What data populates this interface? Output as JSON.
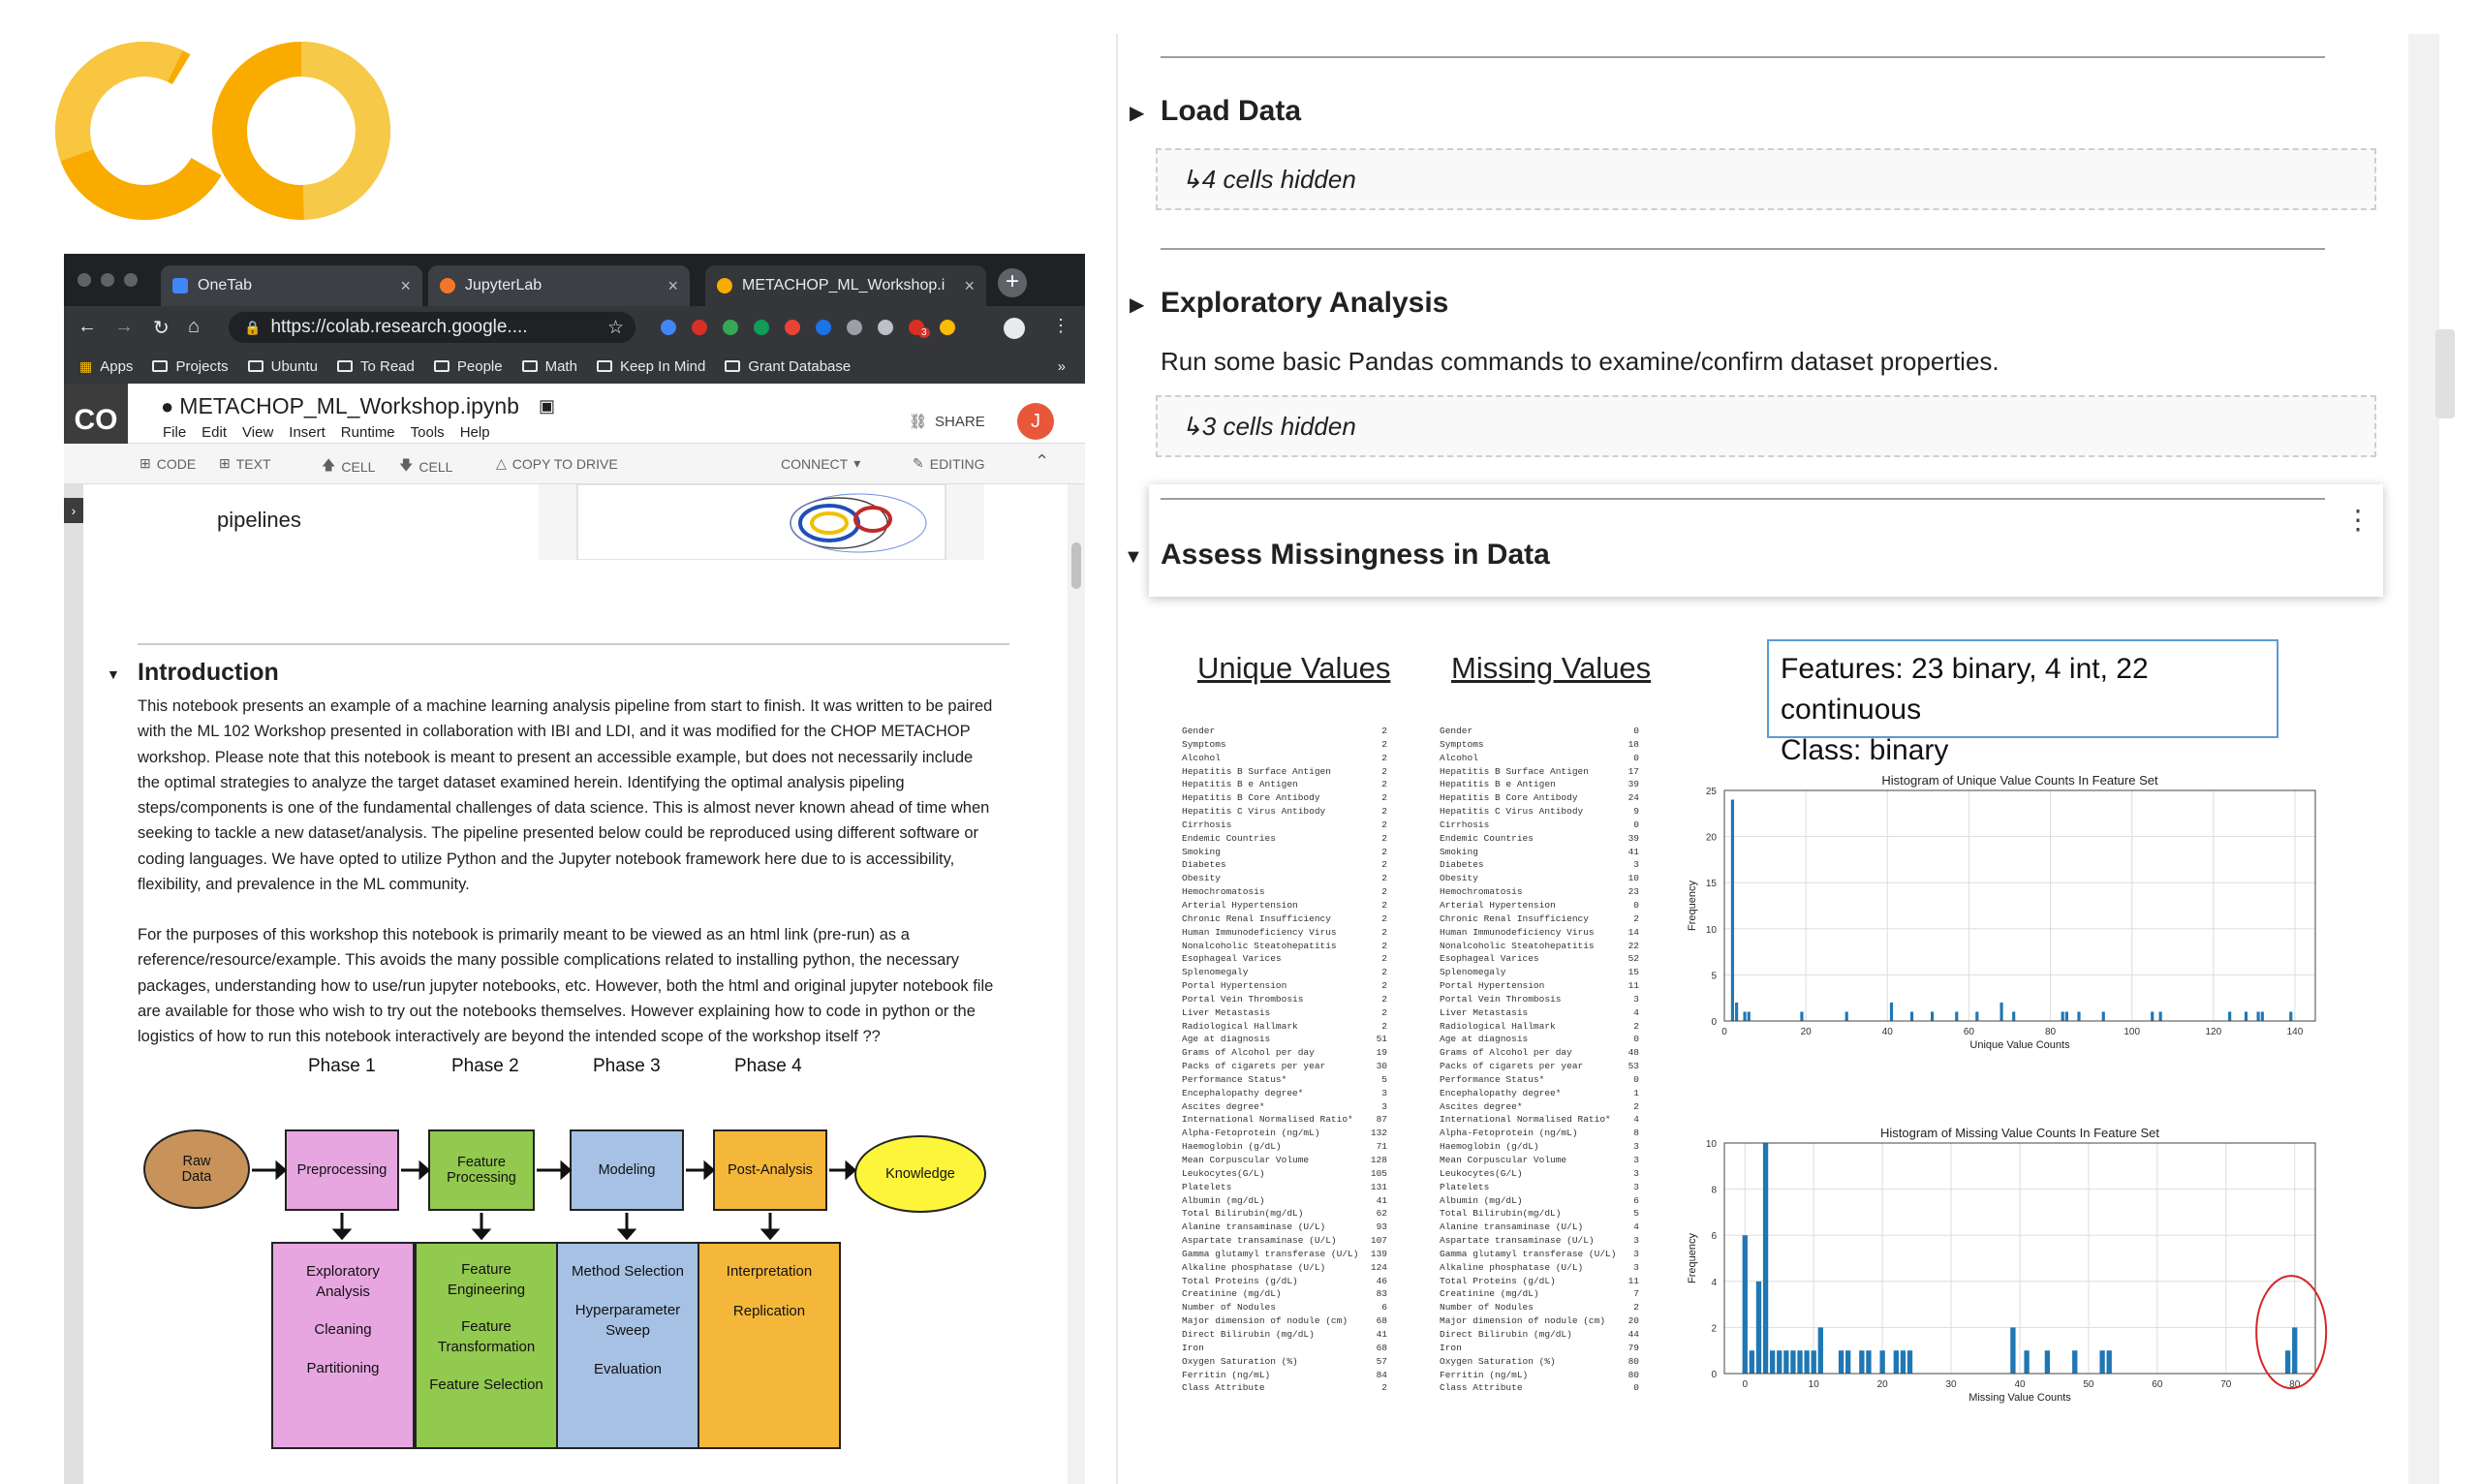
{
  "logo": {
    "text": "CO"
  },
  "browser": {
    "tabs": [
      {
        "title": "OneTab",
        "close": "×",
        "color": "#4285f4"
      },
      {
        "title": "JupyterLab",
        "close": "×",
        "color": "#f37626"
      },
      {
        "title": "METACHOP_ML_Workshop.i",
        "close": "×",
        "color": "#f9ab00"
      }
    ],
    "new_tab": "+",
    "url": "https://colab.research.google....",
    "bookmarks": [
      "Apps",
      "Projects",
      "Ubuntu",
      "To Read",
      "People",
      "Math",
      "Keep In Mind",
      "Grant Database"
    ],
    "more": "»",
    "ext_badge": "3"
  },
  "colab": {
    "logo": "CO",
    "title": "METACHOP_ML_Workshop.ipynb",
    "menus": [
      "File",
      "Edit",
      "View",
      "Insert",
      "Runtime",
      "Tools",
      "Help"
    ],
    "share": "SHARE",
    "avatar": "J",
    "toolbar": {
      "code": "CODE",
      "text": "TEXT",
      "cell_up": "CELL",
      "cell_down": "CELL",
      "copy": "COPY TO DRIVE",
      "connect": "CONNECT",
      "editing": "EDITING"
    },
    "pipelines": "pipelines",
    "intro_heading": "Introduction",
    "intro_p1": "This notebook presents an example of a machine learning analysis pipeline from start to finish. It was written to be paired with the ML 102 Workshop presented in collaboration with IBI and LDI, and it was modified for the CHOP METACHOP workshop. Please note that this notebook is meant to present an accessible example, but does not necessarily include the optimal strategies to analyze the target dataset examined herein. Identifying the optimal analysis pipeling steps/components is one of the fundamental challenges of data science. This is almost never known ahead of time when seeking to tackle a new dataset/analysis. The pipeline presented below could be reproduced using different software or coding languages. We have opted to utilize Python and the Jupyter notebook framework here due to is accessibility, flexibility, and prevalence in the ML community.",
    "intro_p2": "For the purposes of this workshop this notebook is primarily meant to be viewed as an html link (pre-run) as a reference/resource/example. This avoids the many possible complications related to installing python, the necessary packages, understanding how to use/run jupyter notebooks, etc. However, both the html and original jupyter notebook file are available for those who wish to try out the notebooks themselves. However explaining how to code in python or the logistics of how to run this notebook interactively are beyond the intended scope of the workshop itself ??"
  },
  "flow": {
    "phases": [
      "Phase 1",
      "Phase 2",
      "Phase 3",
      "Phase 4"
    ],
    "raw": [
      "Raw",
      "Data"
    ],
    "steps": [
      "Preprocessing",
      "Feature Processing",
      "Modeling",
      "Post-Analysis"
    ],
    "knowledge": "Knowledge",
    "colors": {
      "pre": "#e8a6e0",
      "feat": "#92c94f",
      "model": "#a6c1e4",
      "post": "#f5b73a",
      "raw": "#c8935a",
      "know": "#fdf53a"
    },
    "details": [
      [
        "Exploratory Analysis",
        "Cleaning",
        "Partitioning"
      ],
      [
        "Feature Engineering",
        "Feature Transformation",
        "Feature Selection"
      ],
      [
        "Method Selection",
        "Hyperparameter Sweep",
        "Evaluation"
      ],
      [
        "Interpretation",
        "Replication"
      ]
    ]
  },
  "right": {
    "load_data": "Load Data",
    "load_hidden": "↳4 cells hidden",
    "explore": "Exploratory Analysis",
    "explore_desc": "Run some basic Pandas commands to examine/confirm dataset properties.",
    "explore_hidden": "↳3 cells hidden",
    "assess": "Assess Missingness in Data",
    "unique_title": "Unique Values",
    "missing_title": "Missing Values",
    "features_line1": "Features: 23 binary, 4 int, 22 continuous",
    "features_line2": "Class: binary",
    "features": [
      "Gender",
      "Symptoms",
      "Alcohol",
      "Hepatitis B Surface Antigen",
      "Hepatitis B e Antigen",
      "Hepatitis B Core Antibody",
      "Hepatitis C Virus Antibody",
      "Cirrhosis",
      "Endemic Countries",
      "Smoking",
      "Diabetes",
      "Obesity",
      "Hemochromatosis",
      "Arterial Hypertension",
      "Chronic Renal Insufficiency",
      "Human Immunodeficiency Virus",
      "Nonalcoholic Steatohepatitis",
      "Esophageal Varices",
      "Splenomegaly",
      "Portal Hypertension",
      "Portal Vein Thrombosis",
      "Liver Metastasis",
      "Radiological Hallmark",
      "Age at diagnosis",
      "Grams of Alcohol per day",
      "Packs of cigarets per year",
      "Performance Status*",
      "Encephalopathy degree*",
      "Ascites degree*",
      "International Normalised Ratio*",
      "Alpha-Fetoprotein (ng/mL)",
      "Haemoglobin (g/dL)",
      "Mean Corpuscular Volume",
      "Leukocytes(G/L)",
      "Platelets",
      "Albumin (mg/dL)",
      "Total Bilirubin(mg/dL)",
      "Alanine transaminase (U/L)",
      "Aspartate transaminase (U/L)",
      "Gamma glutamyl transferase (U/L)",
      "Alkaline phosphatase (U/L)",
      "Total Proteins (g/dL)",
      "Creatinine (mg/dL)",
      "Number of Nodules",
      "Major dimension of nodule (cm)",
      "Direct Bilirubin (mg/dL)",
      "Iron",
      "Oxygen Saturation (%)",
      "Ferritin (ng/mL)",
      "Class Attribute"
    ],
    "unique_counts": [
      2,
      2,
      2,
      2,
      2,
      2,
      2,
      2,
      2,
      2,
      2,
      2,
      2,
      2,
      2,
      2,
      2,
      2,
      2,
      2,
      2,
      2,
      2,
      51,
      19,
      30,
      5,
      3,
      3,
      87,
      132,
      71,
      128,
      105,
      131,
      41,
      62,
      93,
      107,
      139,
      124,
      46,
      83,
      6,
      68,
      41,
      68,
      57,
      84,
      2
    ],
    "missing_counts": [
      0,
      18,
      0,
      17,
      39,
      24,
      9,
      0,
      39,
      41,
      3,
      10,
      23,
      0,
      2,
      14,
      22,
      52,
      15,
      11,
      3,
      4,
      2,
      0,
      48,
      53,
      0,
      1,
      2,
      4,
      8,
      3,
      3,
      3,
      3,
      6,
      5,
      4,
      3,
      3,
      3,
      11,
      7,
      2,
      20,
      44,
      79,
      80,
      80,
      0
    ]
  },
  "chart_data": [
    {
      "type": "bar",
      "title": "Histogram of Unique Value Counts In Feature Set",
      "xlabel": "Unique Value Counts",
      "ylabel": "Frequency",
      "xlim": [
        0,
        145
      ],
      "ylim": [
        0,
        25
      ],
      "xticks": [
        0,
        20,
        40,
        60,
        80,
        100,
        120,
        140
      ],
      "yticks": [
        0,
        5,
        10,
        15,
        20,
        25
      ],
      "x": [
        2,
        3,
        5,
        6,
        19,
        30,
        41,
        46,
        51,
        57,
        62,
        68,
        71,
        83,
        84,
        87,
        93,
        105,
        107,
        124,
        128,
        131,
        132,
        139
      ],
      "values": [
        24,
        2,
        1,
        1,
        1,
        1,
        2,
        1,
        1,
        1,
        1,
        2,
        1,
        1,
        1,
        1,
        1,
        1,
        1,
        1,
        1,
        1,
        1,
        1
      ],
      "color": "#1f77b4"
    },
    {
      "type": "bar",
      "title": "Histogram of Missing Value Counts In Feature Set",
      "xlabel": "Missing Value Counts",
      "ylabel": "Frequency",
      "xlim": [
        -3,
        83
      ],
      "ylim": [
        0,
        10
      ],
      "xticks": [
        0,
        10,
        20,
        30,
        40,
        50,
        60,
        70,
        80
      ],
      "yticks": [
        0,
        2,
        4,
        6,
        8,
        10
      ],
      "x": [
        0,
        1,
        2,
        3,
        4,
        5,
        6,
        7,
        8,
        9,
        10,
        11,
        14,
        15,
        17,
        18,
        20,
        22,
        23,
        24,
        39,
        41,
        44,
        48,
        52,
        53,
        79,
        80
      ],
      "values": [
        6,
        1,
        4,
        10,
        1,
        1,
        1,
        1,
        1,
        1,
        1,
        2,
        1,
        1,
        1,
        1,
        1,
        1,
        1,
        1,
        2,
        1,
        1,
        1,
        1,
        1,
        1,
        2
      ],
      "color": "#1f77b4",
      "annotation_color": "#d62728"
    }
  ]
}
